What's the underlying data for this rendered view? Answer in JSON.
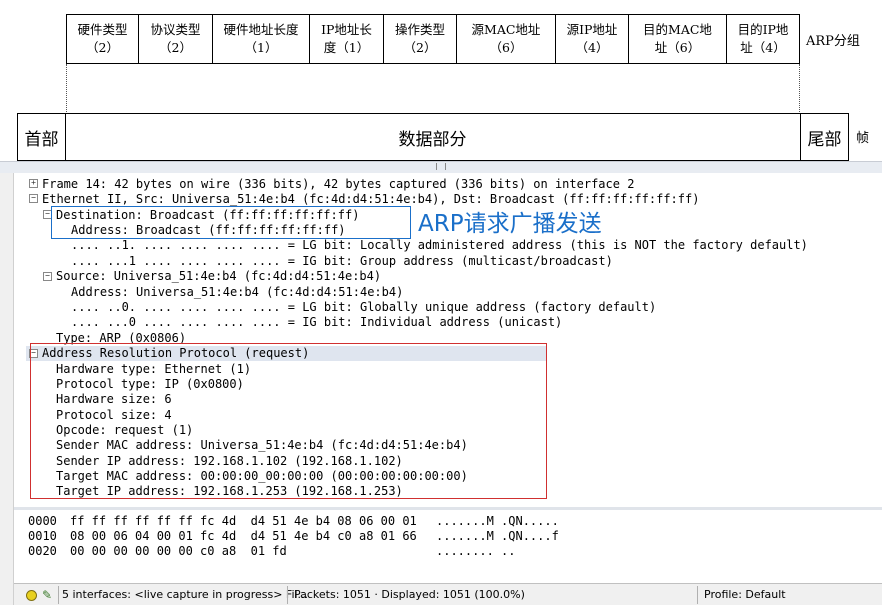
{
  "diagram": {
    "fields": [
      {
        "label": "硬件类型\n（2）"
      },
      {
        "label": "协议类型\n（2）"
      },
      {
        "label": "硬件地址长度\n（1）"
      },
      {
        "label": "IP地址长\n度（1）"
      },
      {
        "label": "操作类型\n（2）"
      },
      {
        "label": "源MAC地址\n（6）"
      },
      {
        "label": "源IP地址\n（4）"
      },
      {
        "label": "目的MAC地\n址（6）"
      },
      {
        "label": "目的IP地\n址（4）"
      }
    ],
    "arp_label": "ARP分组",
    "frame": {
      "header": "首部",
      "data": "数据部分",
      "trailer": "尾部",
      "label": "帧"
    }
  },
  "tree": {
    "frame": "Frame 14: 42 bytes on wire (336 bits), 42 bytes captured (336 bits) on interface 2",
    "ethernet": "Ethernet II, Src: Universa_51:4e:b4 (fc:4d:d4:51:4e:b4), Dst: Broadcast (ff:ff:ff:ff:ff:ff)",
    "dst": "Destination: Broadcast (ff:ff:ff:ff:ff:ff)",
    "dst_addr": "Address: Broadcast (ff:ff:ff:ff:ff:ff)",
    "dst_lg": ".... ..1. .... .... .... .... = LG bit: Locally administered address (this is NOT the factory default)",
    "dst_ig": ".... ...1 .... .... .... .... = IG bit: Group address (multicast/broadcast)",
    "src": "Source: Universa_51:4e:b4 (fc:4d:d4:51:4e:b4)",
    "src_addr": "Address: Universa_51:4e:b4 (fc:4d:d4:51:4e:b4)",
    "src_lg": ".... ..0. .... .... .... .... = LG bit: Globally unique address (factory default)",
    "src_ig": ".... ...0 .... .... .... .... = IG bit: Individual address (unicast)",
    "type": "Type: ARP (0x0806)",
    "arp": "Address Resolution Protocol (request)",
    "hw_type": "Hardware type: Ethernet (1)",
    "proto_type": "Protocol type: IP (0x0800)",
    "hw_size": "Hardware size: 6",
    "proto_size": "Protocol size: 4",
    "opcode": "Opcode: request (1)",
    "sender_mac": "Sender MAC address: Universa_51:4e:b4 (fc:4d:d4:51:4e:b4)",
    "sender_ip": "Sender IP address: 192.168.1.102 (192.168.1.102)",
    "target_mac": "Target MAC address: 00:00:00_00:00:00 (00:00:00:00:00:00)",
    "target_ip": "Target IP address: 192.168.1.253 (192.168.1.253)"
  },
  "annotation": {
    "text": "ARP请求广播发送",
    "color": "#1a6fc9",
    "box_color": "#d03030"
  },
  "hex": {
    "rows": [
      {
        "offset": "0000",
        "bytes": "ff ff ff ff ff ff fc 4d  d4 51 4e b4 08 06 00 01",
        "ascii": ".......M .QN....."
      },
      {
        "offset": "0010",
        "bytes": "08 00 06 04 00 01 fc 4d  d4 51 4e b4 c0 a8 01 66",
        "ascii": ".......M .QN....f"
      },
      {
        "offset": "0020",
        "bytes": "00 00 00 00 00 00 c0 a8  01 fd",
        "ascii": "........ .."
      }
    ]
  },
  "status": {
    "interfaces": "5 interfaces: <live capture in progress> Fil...",
    "packets": "Packets: 1051 · Displayed: 1051 (100.0%)",
    "profile": "Profile: Default",
    "led_color": "#e8d020"
  }
}
